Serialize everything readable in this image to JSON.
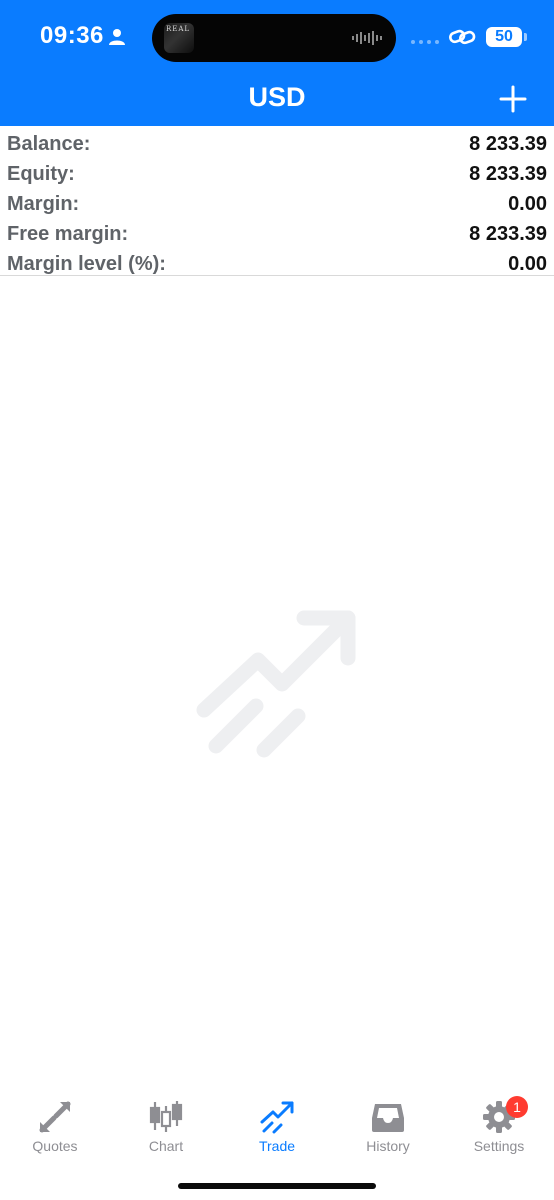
{
  "status_bar": {
    "time": "09:36",
    "island_art_text": "REAL",
    "battery_level": "50",
    "battery_percent": 50
  },
  "header": {
    "title": "USD"
  },
  "account": {
    "rows": [
      {
        "label": "Balance:",
        "value": "8 233.39"
      },
      {
        "label": "Equity:",
        "value": "8 233.39"
      },
      {
        "label": "Margin:",
        "value": "0.00"
      },
      {
        "label": "Free margin:",
        "value": "8 233.39"
      },
      {
        "label": "Margin level (%):",
        "value": "0.00"
      }
    ]
  },
  "tabs": [
    {
      "label": "Quotes",
      "icon": "quotes-icon"
    },
    {
      "label": "Chart",
      "icon": "candlestick-chart-icon"
    },
    {
      "label": "Trade",
      "icon": "trade-icon",
      "active": true
    },
    {
      "label": "History",
      "icon": "inbox-history-icon"
    },
    {
      "label": "Settings",
      "icon": "gear-icon",
      "badge": "1"
    }
  ],
  "colors": {
    "accent": "#0a7cff",
    "badge": "#ff3b30",
    "inactive_tab": "#8e8e93",
    "label": "#5f6368"
  }
}
